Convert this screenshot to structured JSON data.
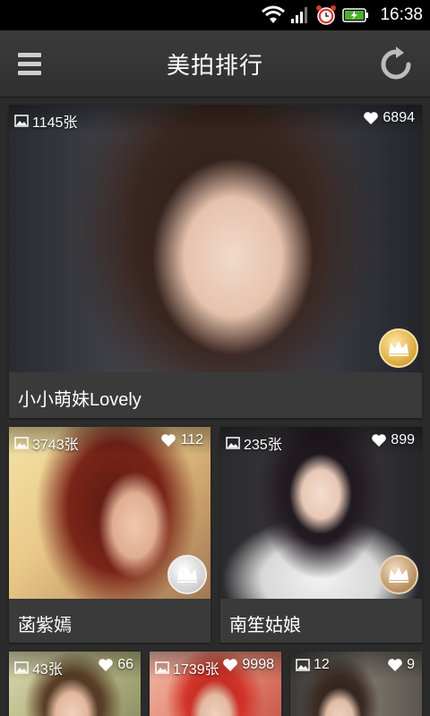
{
  "status_bar": {
    "time": "16:38",
    "icons": [
      "wifi-icon",
      "signal-icon",
      "alarm-icon",
      "battery-charging-icon"
    ]
  },
  "header": {
    "title": "美拍排行",
    "menu_icon": "hamburger-menu-icon",
    "refresh_icon": "refresh-icon"
  },
  "items": [
    {
      "name": "小小萌妹Lovely",
      "photos": "1145张",
      "likes": "6894",
      "rank": 1,
      "crown": "gold"
    },
    {
      "name": "菡紫嫣",
      "photos": "3743张",
      "likes": "112",
      "rank": 2,
      "crown": "silver"
    },
    {
      "name": "南笙姑娘",
      "photos": "235张",
      "likes": "899",
      "rank": 3,
      "crown": "bronze"
    },
    {
      "name": "",
      "photos": "43张",
      "likes": "66",
      "rank": 4
    },
    {
      "name": "",
      "photos": "1739张",
      "likes": "9998",
      "rank": 5
    },
    {
      "name": "",
      "photos": "12",
      "likes": "9",
      "rank": 6
    }
  ],
  "colors": {
    "background": "#2b2b2b",
    "card": "#3a3a3a",
    "header": "#353535",
    "statusbar": "#000000"
  }
}
